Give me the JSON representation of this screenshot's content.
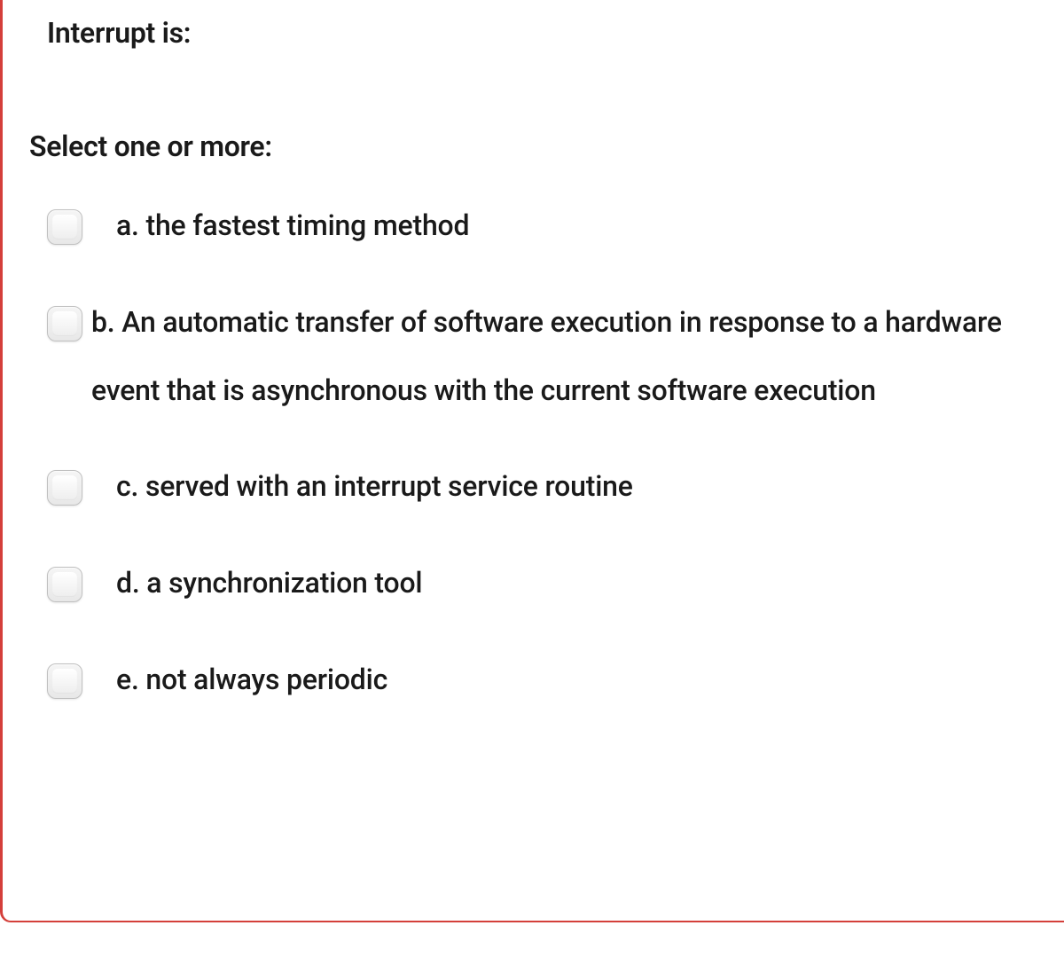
{
  "question": {
    "text": "Interrupt is:",
    "instruction": "Select one or more:",
    "options": [
      {
        "key": "a",
        "label": "a. the fastest timing method"
      },
      {
        "key": "b",
        "label": "b. An automatic transfer of software execution in response to a hardware event that is asynchronous with the current software execution"
      },
      {
        "key": "c",
        "label": "c. served with an interrupt service routine"
      },
      {
        "key": "d",
        "label": "d. a synchronization tool"
      },
      {
        "key": "e",
        "label": "e. not always periodic"
      }
    ]
  }
}
